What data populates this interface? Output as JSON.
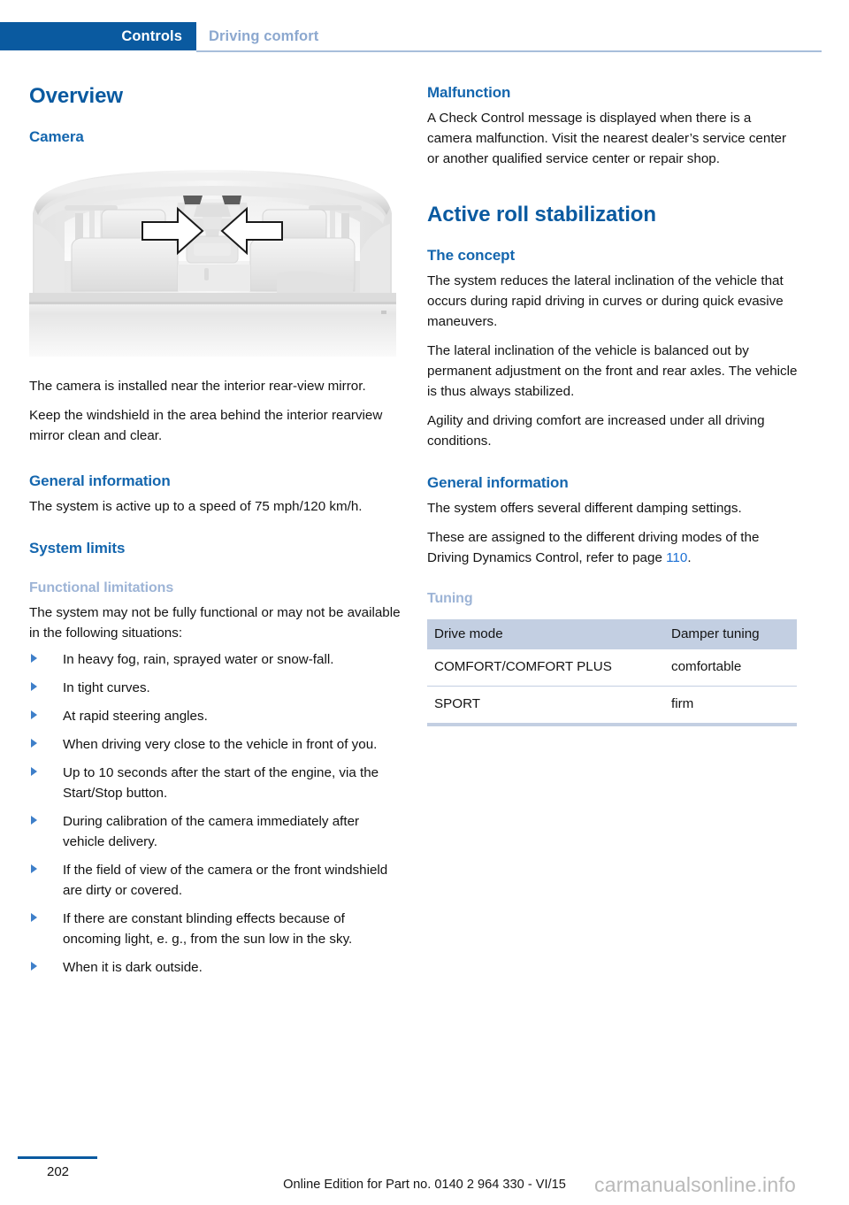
{
  "header": {
    "active_tab": "Controls",
    "inactive_tab": "Driving comfort",
    "active_bg": "#0a5aa0",
    "inactive_color": "#8ca8cf",
    "rule_color": "#a8bedb"
  },
  "left_column": {
    "chapter_title": "Overview",
    "camera_heading": "Camera",
    "figure": {
      "name": "car-interior-rearview-mirror-illustration",
      "description": "Rear view of vehicle interior showing two arrows pointing to the camera area beside the interior rearview mirror"
    },
    "paragraphs": [
      "The camera is installed near the interior rear-view mirror.",
      "Keep the windshield in the area behind the interior rearview mirror clean and clear."
    ],
    "general_information_heading": "General information",
    "general_information_text": "The system is active up to a speed of 75 mph/120 km/h.",
    "system_limits_heading": "System limits",
    "functional_limitations_heading": "Functional limitations",
    "functional_limitations_intro": "The system may not be fully functional or may not be available in the following situations:",
    "functional_limitations_items": [
      "In heavy fog, rain, sprayed water or snow-fall.",
      "In tight curves.",
      "At rapid steering angles.",
      "When driving very close to the vehicle in front of you.",
      "Up to 10 seconds after the start of the engine, via the Start/Stop button.",
      "During calibration of the camera immediately after vehicle delivery.",
      "If the field of view of the camera or the front windshield are dirty or covered.",
      "If there are constant blinding effects because of oncoming light, e. g., from the sun low in the sky.",
      "When it is dark outside."
    ]
  },
  "right_column": {
    "malfunction_heading": "Malfunction",
    "malfunction_text": "A Check Control message is displayed when there is a camera malfunction. Visit the nearest dealer’s service center or another qualified service center or repair shop.",
    "chapter_title": "Active roll stabilization",
    "concept_heading": "The concept",
    "concept_paragraphs": [
      "The system reduces the lateral inclination of the vehicle that occurs during rapid driving in curves or during quick evasive maneuvers.",
      "The lateral inclination of the vehicle is balanced out by permanent adjustment on the front and rear axles. The vehicle is thus always stabilized.",
      "Agility and driving comfort are increased under all driving conditions."
    ],
    "general_information_heading": "General information",
    "general_information_paragraphs": [
      "The system offers several different damping settings."
    ],
    "refer_prefix": "These are assigned to the different driving modes of the Driving Dynamics Control, refer to page ",
    "refer_page": "110",
    "refer_suffix": ".",
    "tuning_heading": "Tuning",
    "table": {
      "columns": [
        "Drive mode",
        "Damper tuning"
      ],
      "rows": [
        [
          "COMFORT/COMFORT PLUS",
          "comfortable"
        ],
        [
          "SPORT",
          "firm"
        ]
      ],
      "header_bg": "#c3cfe2"
    }
  },
  "footer": {
    "page_number": "202",
    "center_text": "Online Edition for Part no. 0140 2 964 330 - VI/15",
    "watermark": "carmanualsonline.info"
  }
}
